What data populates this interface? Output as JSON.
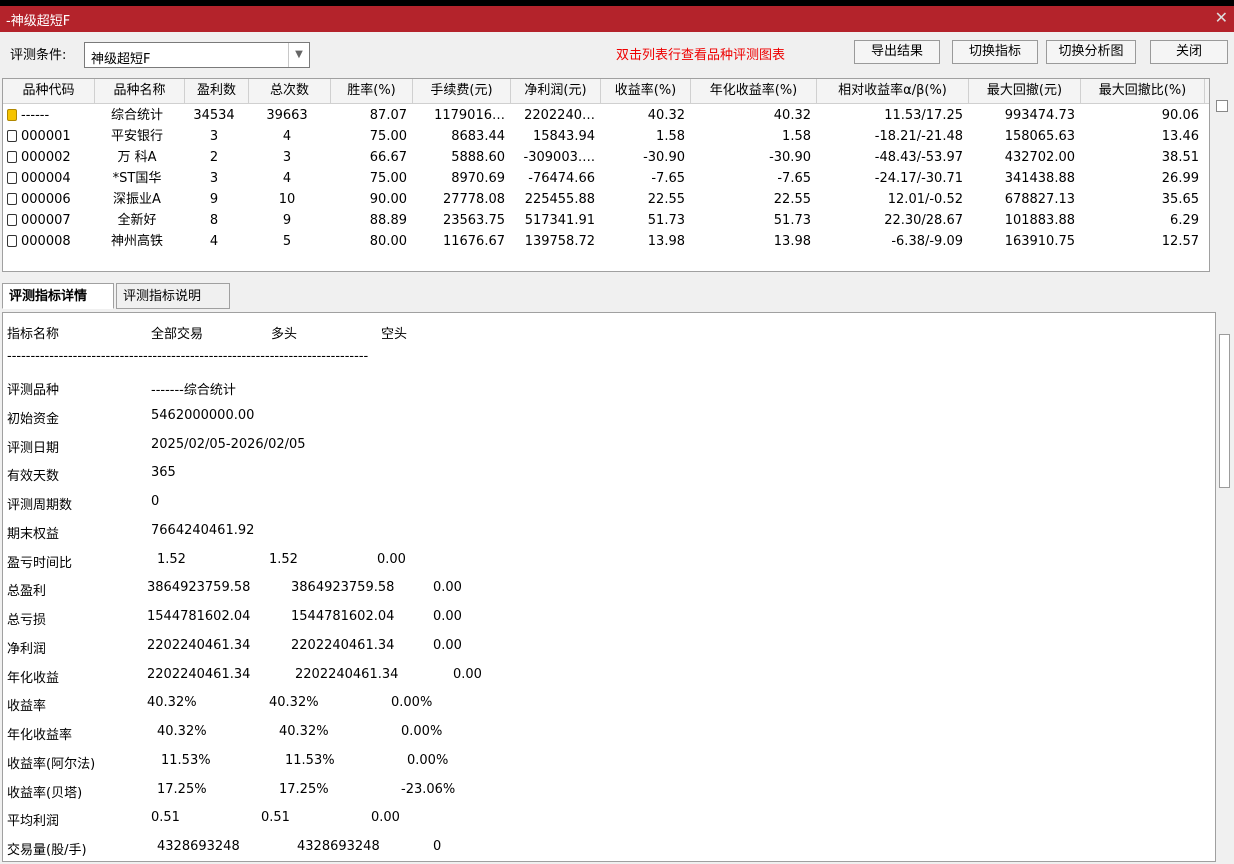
{
  "window": {
    "title": "-神级超短F",
    "close": "✕"
  },
  "toolbar": {
    "condition_label": "评测条件:",
    "condition_value": "神级超短F",
    "hint": "双击列表行查看品种评测图表",
    "buttons": [
      "导出结果",
      "切换指标",
      "切换分析图",
      "关闭"
    ]
  },
  "table": {
    "columns": [
      "品种代码",
      "品种名称",
      "盈利数",
      "总次数",
      "胜率(%)",
      "手续费(元)",
      "净利润(元)",
      "收益率(%)",
      "年化收益率(%)",
      "相对收益率α/β(%)",
      "最大回撤(元)",
      "最大回撤比(%)"
    ],
    "rows": [
      [
        "------",
        "综合统计",
        "34534",
        "39663",
        "87.07",
        "1179016…",
        "2202240…",
        "40.32",
        "40.32",
        "11.53/17.25",
        "993474.73",
        "90.06"
      ],
      [
        "000001",
        "平安银行",
        "3",
        "4",
        "75.00",
        "8683.44",
        "15843.94",
        "1.58",
        "1.58",
        "-18.21/-21.48",
        "158065.63",
        "13.46"
      ],
      [
        "000002",
        "万 科A",
        "2",
        "3",
        "66.67",
        "5888.60",
        "-309003….",
        "-30.90",
        "-30.90",
        "-48.43/-53.97",
        "432702.00",
        "38.51"
      ],
      [
        "000004",
        "*ST国华",
        "3",
        "4",
        "75.00",
        "8970.69",
        "-76474.66",
        "-7.65",
        "-7.65",
        "-24.17/-30.71",
        "341438.88",
        "26.99"
      ],
      [
        "000006",
        "深振业A",
        "9",
        "10",
        "90.00",
        "27778.08",
        "225455.88",
        "22.55",
        "22.55",
        "12.01/-0.52",
        "678827.13",
        "35.65"
      ],
      [
        "000007",
        "全新好",
        "8",
        "9",
        "88.89",
        "23563.75",
        "517341.91",
        "51.73",
        "51.73",
        "22.30/28.67",
        "101883.88",
        "6.29"
      ],
      [
        "000008",
        "神州高铁",
        "4",
        "5",
        "80.00",
        "11676.67",
        "139758.72",
        "13.98",
        "13.98",
        "-6.38/-9.09",
        "163910.75",
        "12.57"
      ]
    ]
  },
  "tabs": [
    "评测指标详情",
    "评测指标说明"
  ],
  "detail": {
    "header": [
      "指标名称",
      "全部交易",
      "多头",
      "空头"
    ],
    "separator": "-----------------------------------------------------------------------------",
    "info": [
      [
        "评测品种",
        "-------综合统计"
      ],
      [
        "初始资金",
        "5462000000.00"
      ],
      [
        "评测日期",
        "2025/02/05-2026/02/05"
      ],
      [
        "有效天数",
        "365"
      ],
      [
        "评测周期数",
        "0"
      ],
      [
        "期末权益",
        "7664240461.92"
      ]
    ],
    "metrics": [
      [
        "盈亏时间比",
        "1.52",
        "1.52",
        "0.00"
      ],
      [
        "总盈利",
        "3864923759.58",
        "3864923759.58",
        "0.00"
      ],
      [
        "总亏损",
        "1544781602.04",
        "1544781602.04",
        "0.00"
      ],
      [
        "净利润",
        "2202240461.34",
        "2202240461.34",
        "0.00"
      ],
      [
        "年化收益",
        "2202240461.34",
        "2202240461.34",
        "0.00"
      ],
      [
        "收益率",
        "40.32%",
        "40.32%",
        "0.00%"
      ],
      [
        "年化收益率",
        "40.32%",
        "40.32%",
        "0.00%"
      ],
      [
        "收益率(阿尔法)",
        "11.53%",
        "11.53%",
        "0.00%"
      ],
      [
        "收益率(贝塔)",
        "17.25%",
        "17.25%",
        "-23.06%"
      ],
      [
        "平均利润",
        "0.51",
        "0.51",
        "0.00"
      ],
      [
        "交易量(股/手)",
        "4328693248",
        "4328693248",
        "0"
      ]
    ]
  }
}
